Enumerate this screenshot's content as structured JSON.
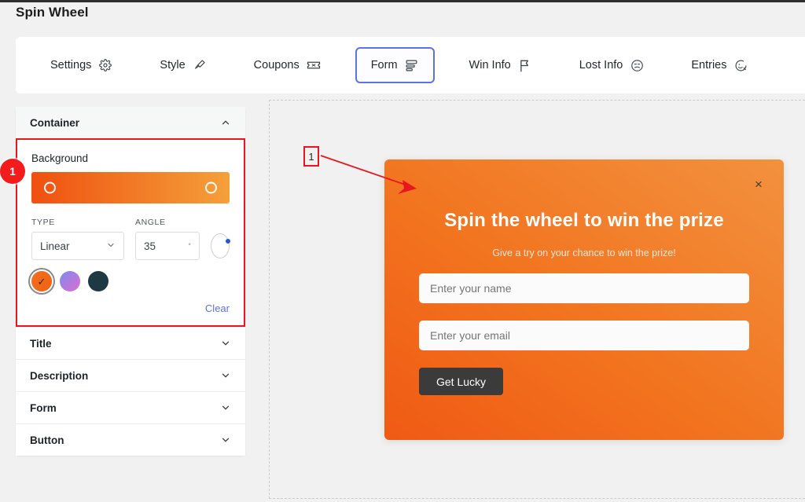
{
  "page": {
    "title": "Spin Wheel"
  },
  "tabs": [
    {
      "label": "Settings",
      "icon": "gear-icon",
      "active": false
    },
    {
      "label": "Style",
      "icon": "brush-icon",
      "active": false
    },
    {
      "label": "Coupons",
      "icon": "ticket-icon",
      "active": false
    },
    {
      "label": "Form",
      "icon": "form-icon",
      "active": true
    },
    {
      "label": "Win Info",
      "icon": "flag-icon",
      "active": false
    },
    {
      "label": "Lost Info",
      "icon": "sad-face-icon",
      "active": false
    },
    {
      "label": "Entries",
      "icon": "face-x-icon",
      "active": false
    }
  ],
  "sidebar": {
    "sections": [
      {
        "label": "Container",
        "expanded": true
      },
      {
        "label": "Title",
        "expanded": false
      },
      {
        "label": "Description",
        "expanded": false
      },
      {
        "label": "Form",
        "expanded": false
      },
      {
        "label": "Button",
        "expanded": false
      }
    ],
    "container": {
      "background_label": "Background",
      "gradient": {
        "from": "#f05010",
        "to": "#f4a03a"
      },
      "type_label": "TYPE",
      "type_value": "Linear",
      "angle_label": "ANGLE",
      "angle_value": "35",
      "angle_unit": "°",
      "swatches": [
        {
          "name": "orange-gradient-swatch",
          "color": "#f37021",
          "selected": true
        },
        {
          "name": "purple-pink-gradient-swatch",
          "color": "#c47be0",
          "selected": false
        },
        {
          "name": "dark-teal-swatch",
          "color": "#1d3944",
          "selected": false
        }
      ],
      "clear_label": "Clear"
    }
  },
  "annotations": {
    "badge_number": "1",
    "callout_number": "1",
    "highlight_color": "#e8161f"
  },
  "preview": {
    "title": "Spin the wheel to win the prize",
    "subtitle": "Give a try on your chance to win the prize!",
    "name_placeholder": "Enter your name",
    "email_placeholder": "Enter your email",
    "button_label": "Get Lucky",
    "close_icon": "×"
  }
}
